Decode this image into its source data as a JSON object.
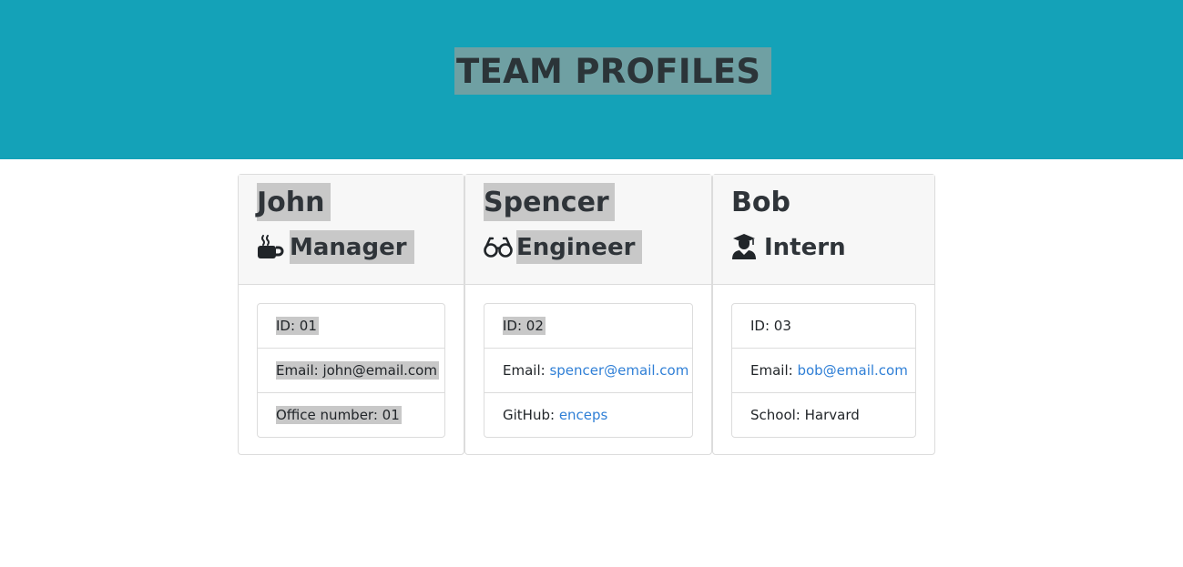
{
  "header": {
    "title": "TEAM PROFILES"
  },
  "cards": [
    {
      "name": "John",
      "role": "Manager",
      "role_icon": "coffee-mug-icon",
      "items": [
        {
          "label": "ID: 01"
        },
        {
          "label": "Email: john@email.com"
        },
        {
          "label": "Office number: 01"
        }
      ]
    },
    {
      "name": "Spencer",
      "role": "Engineer",
      "role_icon": "glasses-icon",
      "items": [
        {
          "label": "ID: 02"
        },
        {
          "label": "Email: ",
          "link": "spencer@email.com"
        },
        {
          "label": "GitHub: ",
          "link": "enceps"
        }
      ]
    },
    {
      "name": "Bob",
      "role": "Intern",
      "role_icon": "graduate-icon",
      "items": [
        {
          "label": "ID: 03"
        },
        {
          "label": "Email: ",
          "link": "bob@email.com"
        },
        {
          "label": "School: Harvard"
        }
      ]
    }
  ],
  "colors": {
    "header_bg": "#14a2b8",
    "title_highlight": "#6fa0a3",
    "text_highlight": "#c8c8c8",
    "link": "#2f7fd6"
  }
}
